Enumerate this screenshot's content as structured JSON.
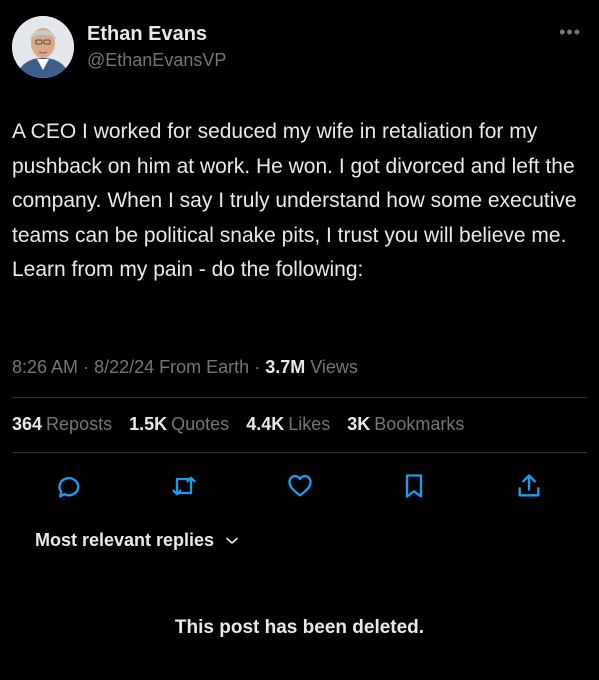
{
  "author": {
    "name": "Ethan Evans",
    "handle": "@EthanEvansVP"
  },
  "header": {
    "more_label": "•••"
  },
  "tweet": {
    "text": "A CEO I worked for seduced my wife in retaliation for my pushback on him at work. He won. I got divorced and left the company. When I say I truly understand how some executive teams can be political snake pits, I trust you will believe me. Learn from my pain - do the following:",
    "time": "8:26 AM",
    "date": "8/22/24",
    "source": "From Earth",
    "views_count": "3.7M",
    "views_label": "Views"
  },
  "stats": {
    "reposts": {
      "count": "364",
      "label": "Reposts"
    },
    "quotes": {
      "count": "1.5K",
      "label": "Quotes"
    },
    "likes": {
      "count": "4.4K",
      "label": "Likes"
    },
    "bookmarks": {
      "count": "3K",
      "label": "Bookmarks"
    }
  },
  "actions": {
    "icons": [
      "reply-icon",
      "repost-icon",
      "like-icon",
      "bookmark-icon",
      "share-icon"
    ],
    "icon_color": "#1d9bf0"
  },
  "replies": {
    "sort_label": "Most relevant replies",
    "deleted_notice": "This post has been deleted."
  }
}
